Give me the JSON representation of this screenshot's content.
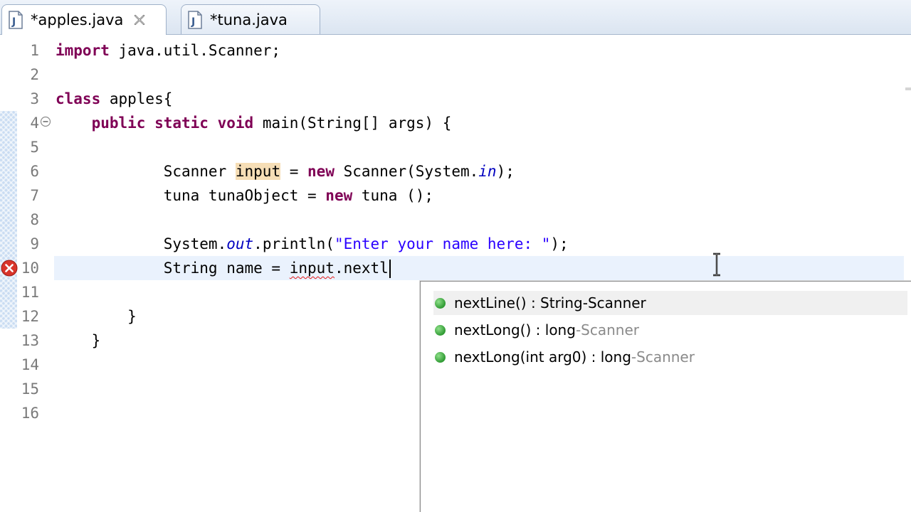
{
  "tabs": [
    {
      "label": "*apples.java",
      "active": true
    },
    {
      "label": "*tuna.java",
      "active": false
    }
  ],
  "editor": {
    "line_numbers": [
      "1",
      "2",
      "3",
      "4",
      "5",
      "6",
      "7",
      "8",
      "9",
      "10",
      "11",
      "12",
      "13",
      "14",
      "15",
      "16"
    ],
    "lines": {
      "l1": {
        "kw": "import",
        "rest": " java.util.Scanner;"
      },
      "l3": {
        "kw": "class",
        "rest": " apples{"
      },
      "l4": {
        "indent": "    ",
        "kw1": "public",
        "kw2": "static",
        "kw3": "void",
        "rest": " main(String[] args) {"
      },
      "l6": {
        "indent": "            ",
        "pre": "Scanner ",
        "var": "input",
        "mid": " = ",
        "kw": "new",
        "post": " Scanner(System.",
        "field": "in",
        "end": ");"
      },
      "l7": {
        "indent": "            ",
        "pre": "tuna tunaObject = ",
        "kw": "new",
        "post": " tuna ();"
      },
      "l9": {
        "indent": "            ",
        "pre": "System.",
        "field": "out",
        "mid": ".println(",
        "str": "\"Enter your name here: \"",
        "end": ");"
      },
      "l10": {
        "indent": "            ",
        "pre": "String name = ",
        "var": "input",
        "post": ".nextl"
      },
      "l12": {
        "indent": "        ",
        "text": "}"
      },
      "l13": {
        "indent": "    ",
        "text": "}"
      }
    }
  },
  "content_assist": {
    "proposals": [
      {
        "signature": "nextLine() : String",
        "separator": " - ",
        "qualifier": "Scanner",
        "selected": true
      },
      {
        "signature": "nextLong() : long",
        "separator": " - ",
        "qualifier": "Scanner",
        "selected": false
      },
      {
        "signature": "nextLong(int arg0) : long",
        "separator": " - ",
        "qualifier": "Scanner",
        "selected": false
      }
    ]
  },
  "colors": {
    "keyword": "#7f0055",
    "string": "#2a00ff",
    "static_field": "#0000c0",
    "occurrence_highlight": "#f6deb6",
    "current_line": "#eaf2fd",
    "error": "#e21818",
    "method_icon": "#2f9a33"
  },
  "icons": {
    "tab_file": "java-file-icon",
    "tab_close": "close-icon",
    "fold": "collapse-icon",
    "error": "error-icon",
    "proposal": "method-public-icon",
    "cursor": "ibeam-cursor-icon"
  }
}
